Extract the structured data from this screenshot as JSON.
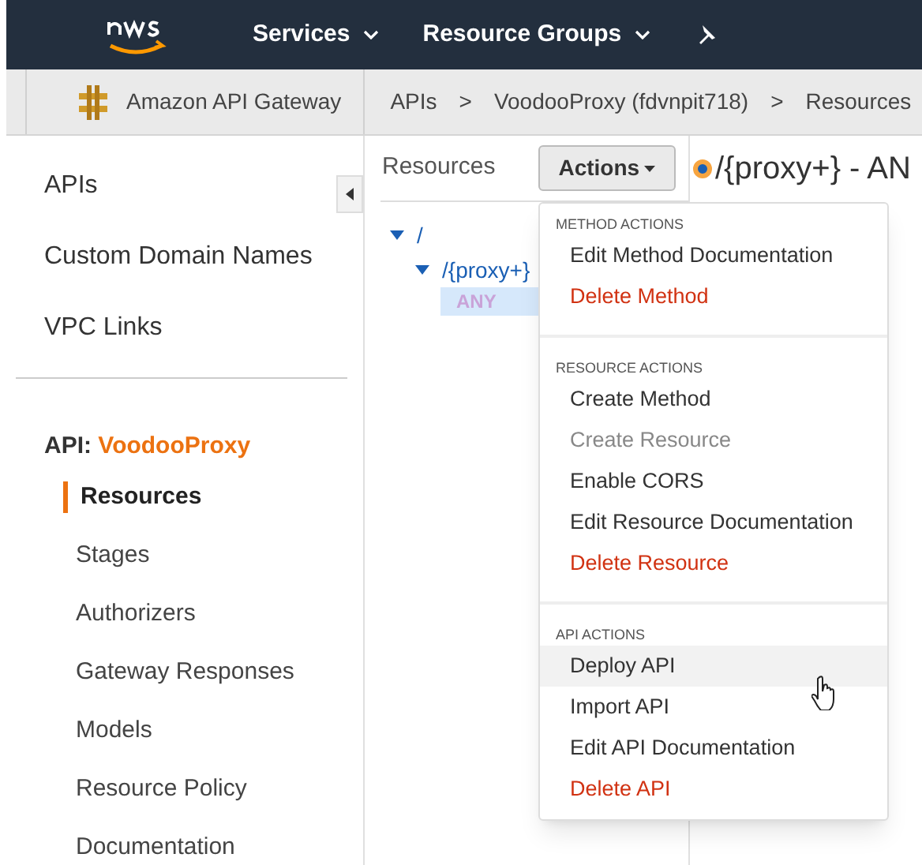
{
  "top_nav": {
    "menus": [
      {
        "label": "Services"
      },
      {
        "label": "Resource Groups"
      }
    ]
  },
  "breadcrumb": {
    "service": "Amazon API Gateway",
    "items": [
      "APIs",
      "VoodooProxy (fdvnpit718)",
      "Resources"
    ],
    "separator": ">"
  },
  "sidebar": {
    "links": [
      {
        "label": "APIs"
      },
      {
        "label": "Custom Domain Names"
      },
      {
        "label": "VPC Links"
      }
    ],
    "api_label": "API:",
    "api_name": "VoodooProxy",
    "items": [
      {
        "label": "Resources",
        "selected": true
      },
      {
        "label": "Stages",
        "selected": false
      },
      {
        "label": "Authorizers",
        "selected": false
      },
      {
        "label": "Gateway Responses",
        "selected": false
      },
      {
        "label": "Models",
        "selected": false
      },
      {
        "label": "Resource Policy",
        "selected": false
      },
      {
        "label": "Documentation",
        "selected": false
      }
    ]
  },
  "resources_panel": {
    "title": "Resources",
    "actions_button": "Actions",
    "tree": [
      {
        "label": "/",
        "expanded": true,
        "children": [
          {
            "label": "/{proxy+}",
            "expanded": true,
            "methods": [
              {
                "label": "ANY",
                "selected": true
              }
            ]
          }
        ]
      }
    ]
  },
  "detail": {
    "heading": "/{proxy+} - AN"
  },
  "actions_menu": [
    {
      "title": "METHOD ACTIONS",
      "items": [
        {
          "label": "Edit Method Documentation",
          "danger": false,
          "disabled": false,
          "hovered": false
        },
        {
          "label": "Delete Method",
          "danger": true,
          "disabled": false,
          "hovered": false
        }
      ]
    },
    {
      "title": "RESOURCE ACTIONS",
      "items": [
        {
          "label": "Create Method",
          "danger": false,
          "disabled": false,
          "hovered": false
        },
        {
          "label": "Create Resource",
          "danger": false,
          "disabled": true,
          "hovered": false
        },
        {
          "label": "Enable CORS",
          "danger": false,
          "disabled": false,
          "hovered": false
        },
        {
          "label": "Edit Resource Documentation",
          "danger": false,
          "disabled": false,
          "hovered": false
        },
        {
          "label": "Delete Resource",
          "danger": true,
          "disabled": false,
          "hovered": false
        }
      ]
    },
    {
      "title": "API ACTIONS",
      "items": [
        {
          "label": "Deploy API",
          "danger": false,
          "disabled": false,
          "hovered": true
        },
        {
          "label": "Import API",
          "danger": false,
          "disabled": false,
          "hovered": false
        },
        {
          "label": "Edit API Documentation",
          "danger": false,
          "disabled": false,
          "hovered": false
        },
        {
          "label": "Delete API",
          "danger": true,
          "disabled": false,
          "hovered": false
        }
      ]
    }
  ]
}
